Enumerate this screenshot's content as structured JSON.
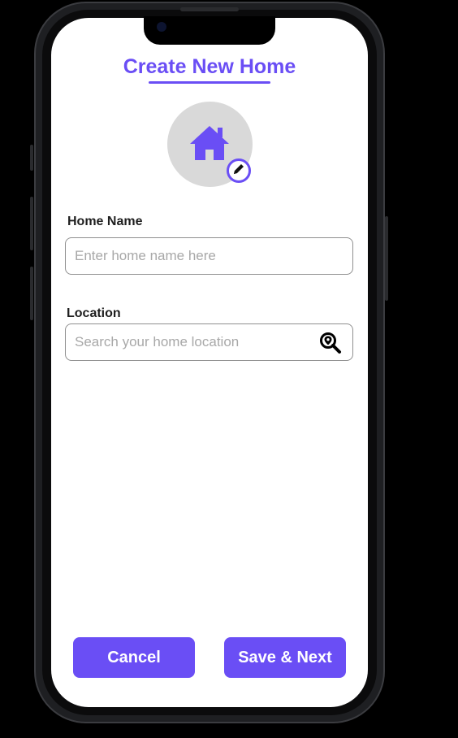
{
  "page": {
    "title": "Create New Home"
  },
  "home_image": {
    "icon": "house-icon",
    "edit_icon": "pencil-icon"
  },
  "form": {
    "home_name": {
      "label": "Home Name",
      "value": "",
      "placeholder": "Enter home name here"
    },
    "location": {
      "label": "Location",
      "value": "",
      "placeholder": "Search your home location",
      "icon": "location-search-icon"
    }
  },
  "actions": {
    "cancel_label": "Cancel",
    "save_next_label": "Save & Next"
  },
  "colors": {
    "accent": "#6a4ef5",
    "avatar_bg": "#d9d9d9",
    "placeholder": "#a8a8a8"
  }
}
